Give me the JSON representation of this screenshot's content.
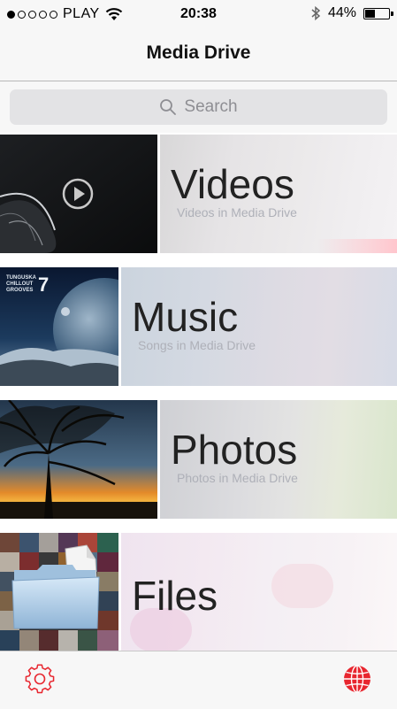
{
  "status_bar": {
    "carrier": "PLAY",
    "signal_filled": 1,
    "signal_total": 5,
    "time": "20:38",
    "battery_text": "44%",
    "battery_level": 0.44
  },
  "nav": {
    "title": "Media Drive"
  },
  "search": {
    "placeholder": "Search"
  },
  "categories": [
    {
      "title": "Videos",
      "subtitle": "Videos in Media Drive"
    },
    {
      "title": "Music",
      "subtitle": "Songs in Media Drive",
      "album_text": "TUNGUSKA CHILLOUT GROOVES",
      "album_number": "7"
    },
    {
      "title": "Photos",
      "subtitle": "Photos in Media Drive"
    },
    {
      "title": "Files",
      "subtitle": ""
    }
  ],
  "tab_bar": {
    "settings_icon": "gear-icon",
    "web_icon": "globe-icon"
  },
  "colors": {
    "accent": "#e8262f",
    "background": "#f7f7f7"
  }
}
